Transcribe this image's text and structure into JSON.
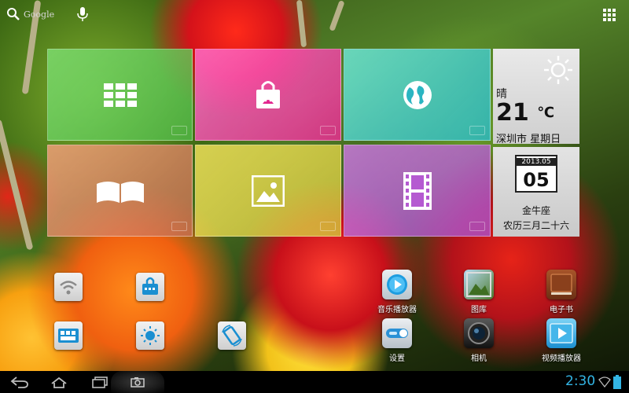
{
  "top_bar": {
    "search_label": "Google",
    "icons": [
      "search-icon",
      "mic-icon",
      "all-apps-icon"
    ]
  },
  "tiles": [
    {
      "name": "app-grid",
      "color": "#63c94a",
      "icon": "grid-icon"
    },
    {
      "name": "store",
      "color": "#ff3ea8",
      "icon": "shopping-bag-icon"
    },
    {
      "name": "browser",
      "color": "#2fc9c9",
      "icon": "globe-icon"
    },
    {
      "name": "reader",
      "color": "#e0895a",
      "icon": "book-icon"
    },
    {
      "name": "gallery",
      "color": "#d9cf45",
      "icon": "picture-icon"
    },
    {
      "name": "video",
      "color": "#b25cd4",
      "icon": "film-icon"
    }
  ],
  "weather": {
    "condition": "晴",
    "temperature": "21",
    "unit": "℃",
    "location_day": "深圳市 星期日",
    "icon": "sun-icon"
  },
  "calendar": {
    "year_month": "2013.05",
    "day": "05",
    "zodiac": "金牛座",
    "lunar_date": "农历三月二十六"
  },
  "quick_settings": [
    {
      "name": "wifi-toggle",
      "icon": "wifi-icon"
    },
    {
      "name": "lock-toggle",
      "icon": "lock-icon"
    },
    {
      "name": "keyboard-toggle",
      "icon": "keyboard-icon"
    },
    {
      "name": "brightness-toggle",
      "icon": "brightness-icon"
    },
    {
      "name": "rotation-toggle",
      "icon": "rotate-icon"
    }
  ],
  "apps": [
    {
      "label": "音乐播放器",
      "icon": "music-player-icon"
    },
    {
      "label": "图库",
      "icon": "gallery-icon"
    },
    {
      "label": "电子书",
      "icon": "ebook-icon"
    },
    {
      "label": "设置",
      "icon": "settings-icon"
    },
    {
      "label": "相机",
      "icon": "camera-icon"
    },
    {
      "label": "视频播放器",
      "icon": "video-player-icon"
    }
  ],
  "status_bar": {
    "time": "2:30",
    "accent": "#33b5e5",
    "icons": [
      "back-icon",
      "home-icon",
      "recent-apps-icon",
      "screenshot-icon",
      "wifi-status-icon",
      "battery-icon"
    ]
  }
}
